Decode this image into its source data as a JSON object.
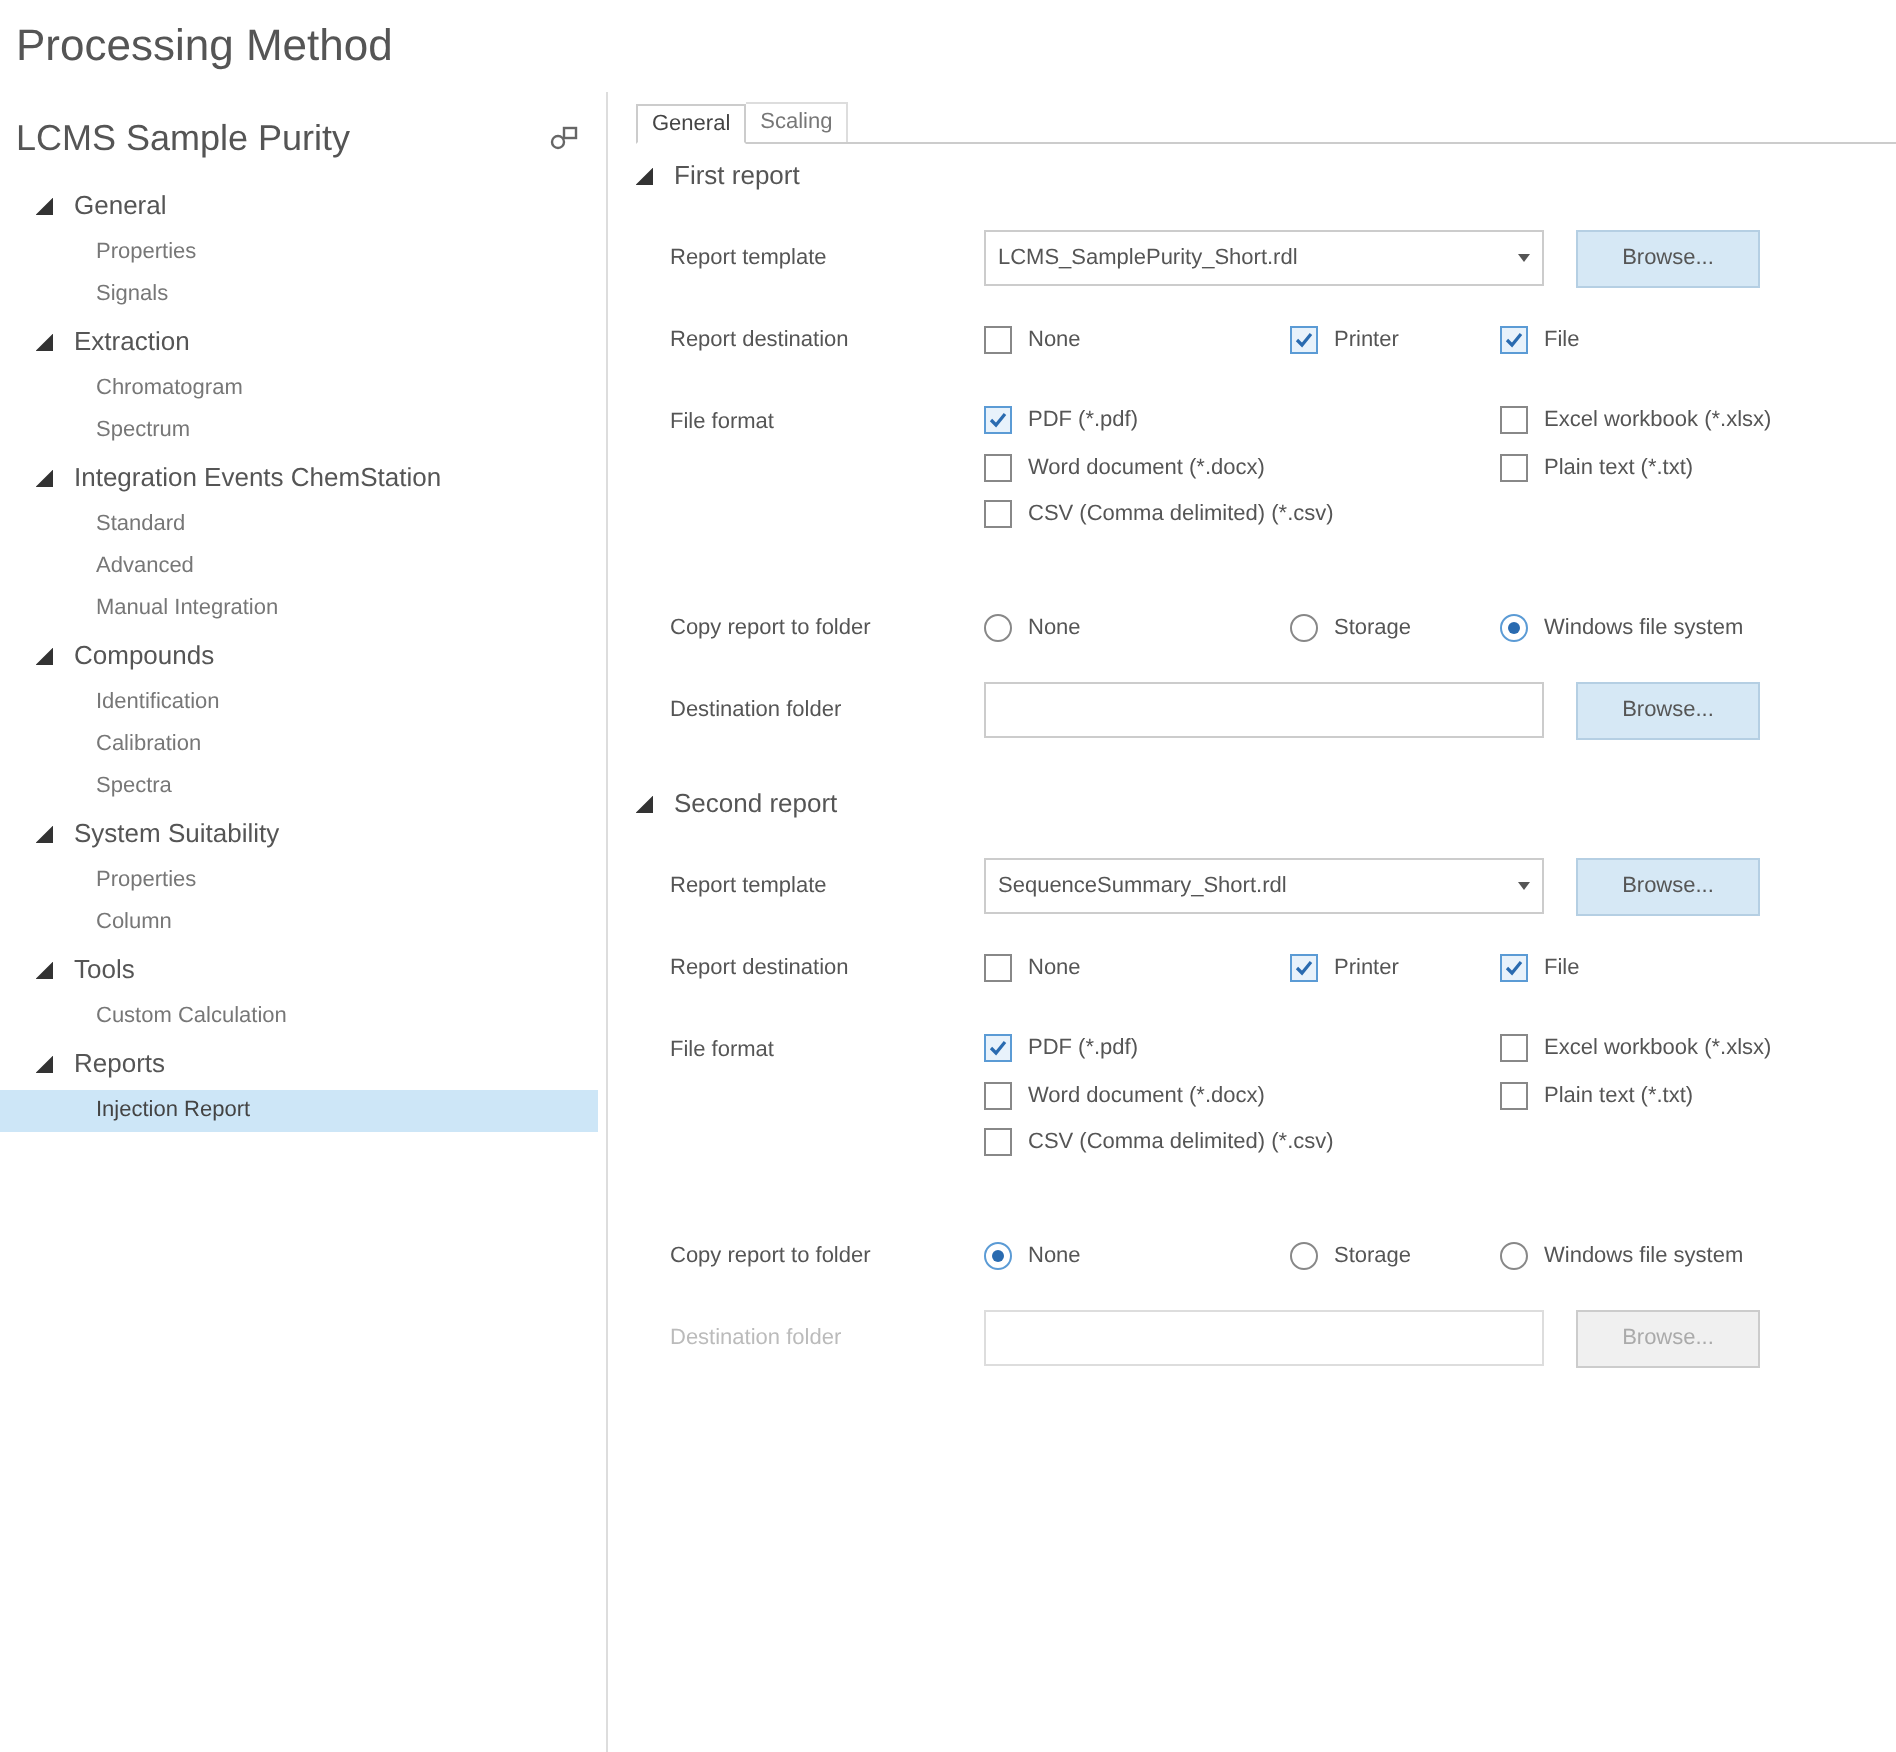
{
  "window": {
    "title": "Processing Method"
  },
  "sidebar": {
    "title": "LCMS Sample Purity",
    "groups": [
      {
        "label": "General",
        "expanded": true,
        "children": [
          {
            "label": "Properties",
            "selected": false
          },
          {
            "label": "Signals",
            "selected": false
          }
        ]
      },
      {
        "label": "Extraction",
        "expanded": true,
        "children": [
          {
            "label": "Chromatogram",
            "selected": false
          },
          {
            "label": "Spectrum",
            "selected": false
          }
        ]
      },
      {
        "label": "Integration Events ChemStation",
        "expanded": true,
        "children": [
          {
            "label": "Standard",
            "selected": false
          },
          {
            "label": "Advanced",
            "selected": false
          },
          {
            "label": "Manual Integration",
            "selected": false
          }
        ]
      },
      {
        "label": "Compounds",
        "expanded": true,
        "children": [
          {
            "label": "Identification",
            "selected": false
          },
          {
            "label": "Calibration",
            "selected": false
          },
          {
            "label": "Spectra",
            "selected": false
          }
        ]
      },
      {
        "label": "System Suitability",
        "expanded": true,
        "children": [
          {
            "label": "Properties",
            "selected": false
          },
          {
            "label": "Column",
            "selected": false
          }
        ]
      },
      {
        "label": "Tools",
        "expanded": true,
        "children": [
          {
            "label": "Custom Calculation",
            "selected": false
          }
        ]
      },
      {
        "label": "Reports",
        "expanded": true,
        "children": [
          {
            "label": "Injection Report",
            "selected": true
          }
        ]
      }
    ]
  },
  "tabs": [
    {
      "label": "General",
      "selected": true
    },
    {
      "label": "Scaling",
      "selected": false
    }
  ],
  "sections": [
    {
      "title": "First report",
      "expanded": true,
      "template": {
        "label": "Report template",
        "value": "LCMS_SamplePurity_Short.rdl",
        "browse": "Browse..."
      },
      "destination": {
        "label": "Report destination",
        "options": [
          {
            "label": "None",
            "checked": false
          },
          {
            "label": "Printer",
            "checked": true
          },
          {
            "label": "File",
            "checked": true
          }
        ]
      },
      "file_format": {
        "label": "File format",
        "options": [
          {
            "label": "PDF (*.pdf)",
            "checked": true
          },
          {
            "label": "Excel workbook (*.xlsx)",
            "checked": false
          },
          {
            "label": "Word document (*.docx)",
            "checked": false
          },
          {
            "label": "Plain text (*.txt)",
            "checked": false
          },
          {
            "label": "CSV (Comma delimited) (*.csv)",
            "checked": false
          }
        ]
      },
      "copy_to_folder": {
        "label": "Copy report to folder",
        "options": [
          {
            "label": "None",
            "selected": false
          },
          {
            "label": "Storage",
            "selected": false
          },
          {
            "label": "Windows file system",
            "selected": true
          }
        ]
      },
      "destination_folder": {
        "label": "Destination folder",
        "disabled": false,
        "browse": "Browse..."
      }
    },
    {
      "title": "Second report",
      "expanded": true,
      "template": {
        "label": "Report template",
        "value": "SequenceSummary_Short.rdl",
        "browse": "Browse..."
      },
      "destination": {
        "label": "Report destination",
        "options": [
          {
            "label": "None",
            "checked": false
          },
          {
            "label": "Printer",
            "checked": true
          },
          {
            "label": "File",
            "checked": true
          }
        ]
      },
      "file_format": {
        "label": "File format",
        "options": [
          {
            "label": "PDF (*.pdf)",
            "checked": true
          },
          {
            "label": "Excel workbook (*.xlsx)",
            "checked": false
          },
          {
            "label": "Word document (*.docx)",
            "checked": false
          },
          {
            "label": "Plain text (*.txt)",
            "checked": false
          },
          {
            "label": "CSV (Comma delimited) (*.csv)",
            "checked": false
          }
        ]
      },
      "copy_to_folder": {
        "label": "Copy report to folder",
        "options": [
          {
            "label": "None",
            "selected": true
          },
          {
            "label": "Storage",
            "selected": false
          },
          {
            "label": "Windows file system",
            "selected": false
          }
        ]
      },
      "destination_folder": {
        "label": "Destination folder",
        "disabled": true,
        "browse": "Browse..."
      }
    }
  ]
}
